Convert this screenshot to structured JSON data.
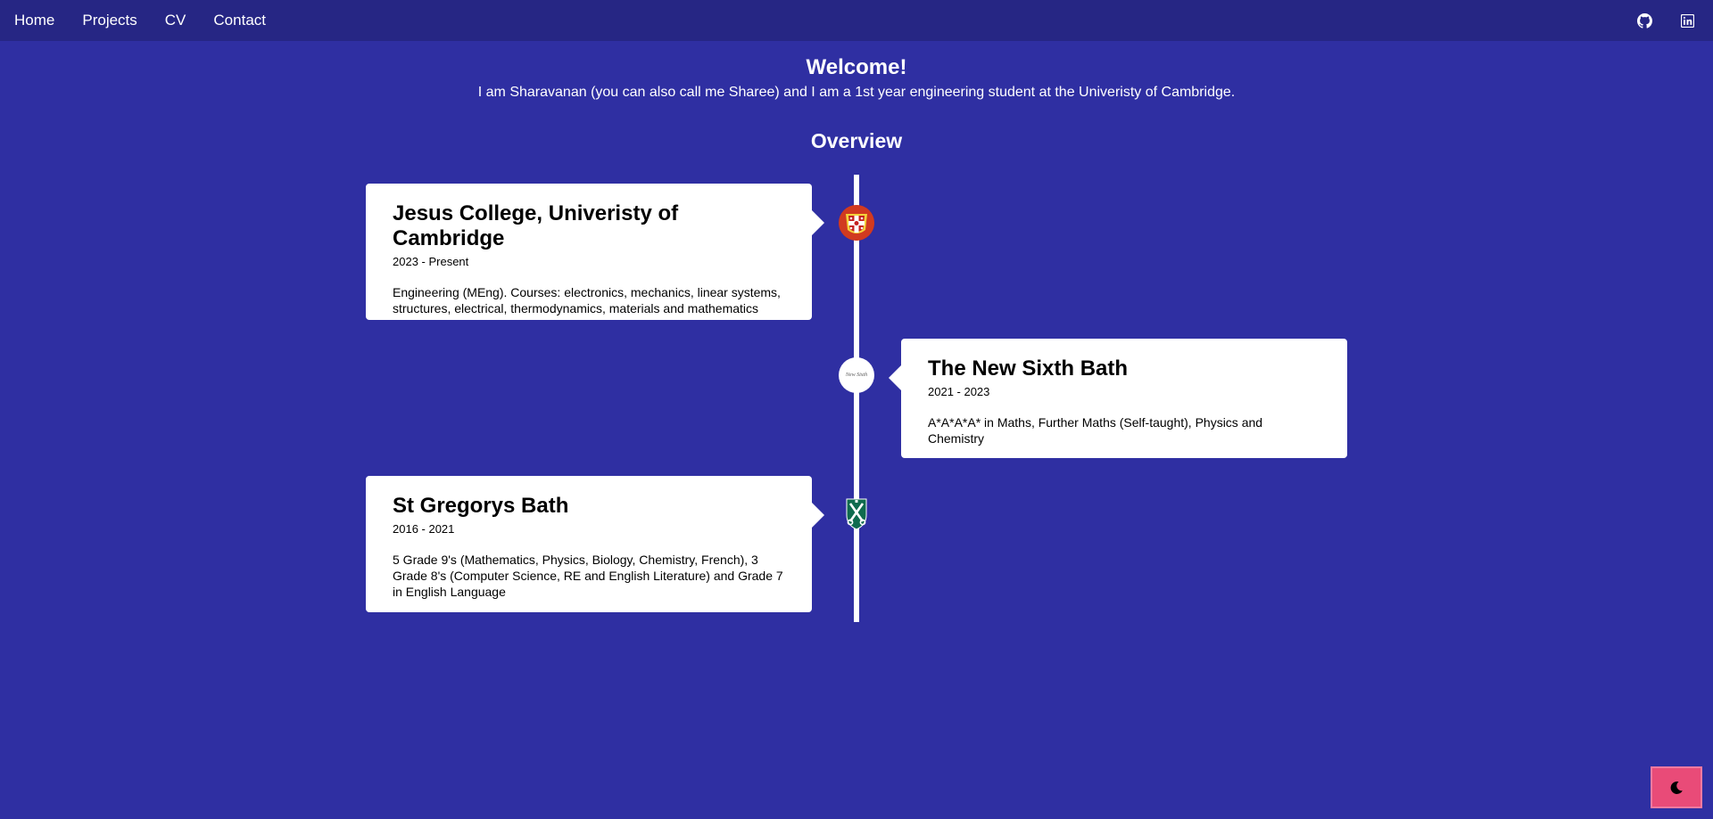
{
  "nav": {
    "links": [
      "Home",
      "Projects",
      "CV",
      "Contact"
    ],
    "icons": [
      "github-icon",
      "linkedin-icon"
    ]
  },
  "header": {
    "welcome": "Welcome!",
    "intro": "I am Sharavanan (you can also call me Sharee) and I am a 1st year engineering student at the Univeristy of Cambridge."
  },
  "overview": {
    "title": "Overview",
    "items": [
      {
        "title": "Jesus College, Univeristy of Cambridge",
        "date": "2023 - Present",
        "desc": "Engineering (MEng). Courses: electronics, mechanics, linear systems, structures, electrical, thermodynamics, materials and mathematics",
        "logo": "jesus-college-crest-icon"
      },
      {
        "title": "The New Sixth Bath",
        "date": "2021 - 2023",
        "desc": "A*A*A*A* in Maths, Further Maths (Self-taught), Physics and Chemistry",
        "logo": "new-sixth-logo-icon",
        "logo_text": "New Sixth"
      },
      {
        "title": "St Gregorys Bath",
        "date": "2016 - 2021",
        "desc": "5 Grade 9's (Mathematics, Physics, Biology, Chemistry, French), 3 Grade 8's (Computer Science, RE and English Literature) and Grade 7 in English Language",
        "logo": "st-gregorys-crest-icon"
      }
    ]
  },
  "theme_toggle": {
    "icon": "moon-icon"
  },
  "colors": {
    "background": "#2f2fa2",
    "navbar": "#262684",
    "toggle": "#e94b78"
  }
}
